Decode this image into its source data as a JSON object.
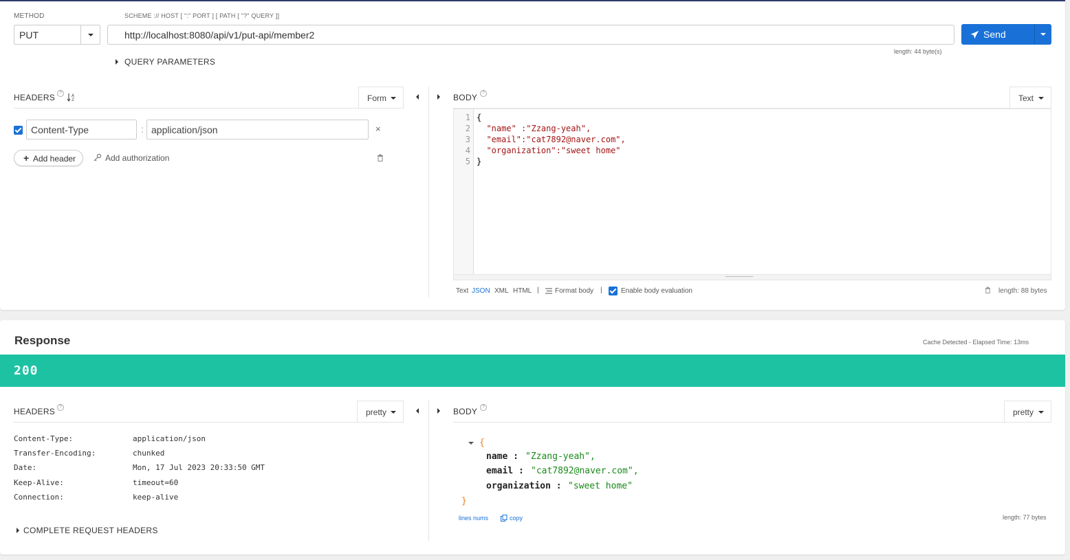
{
  "request": {
    "method_label": "METHOD",
    "method": "PUT",
    "url_label": "SCHEME :// HOST [ \":\" PORT ] [ PATH [ \"?\" QUERY ]]",
    "url": "http://localhost:8080/api/v1/put-api/member2",
    "url_length": "length: 44 byte(s)",
    "send_label": "Send",
    "query_params_label": "QUERY PARAMETERS",
    "headers": {
      "title": "HEADERS",
      "mode": "Form",
      "rows": [
        {
          "enabled": true,
          "name": "Content-Type",
          "value": "application/json"
        }
      ],
      "add_header": "Add header",
      "add_auth": "Add authorization"
    },
    "body": {
      "title": "BODY",
      "mode": "Text",
      "line_numbers": [
        "1",
        "2",
        "3",
        "4",
        "5"
      ],
      "lines": [
        "{",
        "  \"name\" :\"Zzang-yeah\",",
        "  \"email\":\"cat7892@naver.com\",",
        "  \"organization\":\"sweet home\"",
        "}"
      ],
      "footer": {
        "formats": [
          "Text",
          "JSON",
          "XML",
          "HTML"
        ],
        "active_format": "JSON",
        "format_body": "Format body",
        "enable_eval": "Enable body evaluation",
        "length": "length: 88 bytes"
      }
    }
  },
  "response": {
    "title": "Response",
    "cache_info": "Cache Detected - Elapsed Time: 13ms",
    "status": "200",
    "status_color": "#1dc2a3",
    "headers": {
      "title": "HEADERS",
      "mode": "pretty",
      "rows": [
        {
          "key": "Content-Type:",
          "value": "application/json"
        },
        {
          "key": "Transfer-Encoding:",
          "value": "chunked"
        },
        {
          "key": "Date:",
          "value": "Mon, 17 Jul 2023 20:33:50 GMT"
        },
        {
          "key": "Keep-Alive:",
          "value": "timeout=60"
        },
        {
          "key": "Connection:",
          "value": "keep-alive"
        }
      ],
      "complete_headers": "COMPLETE REQUEST HEADERS"
    },
    "body": {
      "title": "BODY",
      "mode": "pretty",
      "open_brace": "{",
      "close_brace": "}",
      "fields": [
        {
          "key": "name :",
          "value": "\"Zzang-yeah\","
        },
        {
          "key": "email :",
          "value": "\"cat7892@naver.com\","
        },
        {
          "key": "organization :",
          "value": "\"sweet home\""
        }
      ],
      "lines_nums": "lines nums",
      "copy": "copy",
      "length": "length: 77 bytes"
    }
  },
  "colors": {
    "accent": "#1971d8",
    "success": "#1dc2a3",
    "header_border": "#2c3b6b"
  }
}
